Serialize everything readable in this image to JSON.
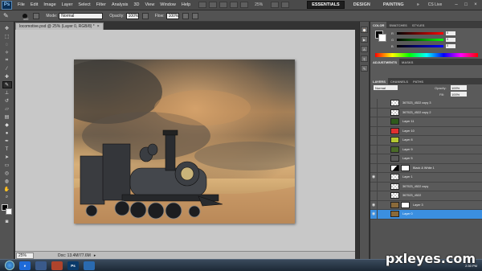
{
  "app": {
    "logo": "Ps",
    "menu": [
      "File",
      "Edit",
      "Image",
      "Layer",
      "Select",
      "Filter",
      "Analysis",
      "3D",
      "View",
      "Window",
      "Help"
    ],
    "zoom_readout": "25%",
    "workspaces": [
      "ESSENTIALS",
      "DESIGN",
      "PAINTING",
      "»"
    ],
    "active_workspace": "ESSENTIALS",
    "cslive": "CS Live"
  },
  "options": {
    "brush_size": "400",
    "mode_label": "Mode:",
    "mode_value": "Normal",
    "opacity_label": "Opacity:",
    "opacity_value": "100%",
    "flow_label": "Flow:",
    "flow_value": "100%"
  },
  "document": {
    "tab_title": "locomotive.psd @ 25% (Layer 0, RGB/8) *",
    "zoom": "25%",
    "doc_info": "Doc: 13.4M/77.6M"
  },
  "color_panel": {
    "tabs": [
      "COLOR",
      "SWATCHES",
      "STYLES"
    ],
    "channels": [
      {
        "label": "R",
        "value": "0"
      },
      {
        "label": "G",
        "value": "0"
      },
      {
        "label": "B",
        "value": "0"
      }
    ]
  },
  "adjust_panel": {
    "tabs": [
      "ADJUSTMENTS",
      "MASKS"
    ]
  },
  "layers_panel": {
    "tabs": [
      "LAYERS",
      "CHANNELS",
      "PATHS"
    ],
    "blend_mode": "Normal",
    "opacity_label": "Opacity:",
    "opacity_value": "100%",
    "fill_label": "Fill:",
    "fill_value": "100%",
    "layers": [
      {
        "name": "367523_4522 copy 3",
        "thumb": "checker",
        "visible": false,
        "selected": false
      },
      {
        "name": "367523_4522 copy 2",
        "thumb": "checker",
        "visible": false,
        "selected": false
      },
      {
        "name": "Layer 11",
        "thumb": "#2f5a1c",
        "visible": false,
        "selected": false
      },
      {
        "name": "Layer 10",
        "thumb": "#e03030",
        "visible": false,
        "selected": false
      },
      {
        "name": "Layer 8",
        "thumb": "#b5c832",
        "visible": false,
        "selected": false
      },
      {
        "name": "Layer 9",
        "thumb": "#4a6a28",
        "visible": false,
        "selected": false
      },
      {
        "name": "Layer 5",
        "thumb": "#5a5a5a",
        "visible": false,
        "selected": false
      },
      {
        "name": "Black & White 1",
        "thumb": "adjust",
        "visible": false,
        "selected": false
      },
      {
        "name": "Layer 1",
        "thumb": "checker",
        "visible": true,
        "selected": false
      },
      {
        "name": "367523_4522 copy",
        "thumb": "checker",
        "visible": false,
        "selected": false
      },
      {
        "name": "367523_4522",
        "thumb": "checker",
        "visible": false,
        "selected": false
      },
      {
        "name": "Layer 3",
        "thumb": "#8a6a3a",
        "visible": true,
        "selected": false
      },
      {
        "name": "Layer 0",
        "thumb": "#8a6a3a",
        "visible": true,
        "selected": true
      }
    ]
  },
  "taskbar": {
    "apps": [
      {
        "label": "e",
        "color": "#1e6ad8"
      },
      {
        "label": "",
        "color": "#3a5a8a"
      },
      {
        "label": "",
        "color": "#b0442c"
      },
      {
        "label": "Ps",
        "color": "#0a3a6a"
      },
      {
        "label": "",
        "color": "#2a6ab0"
      }
    ],
    "tray_time": "2:30 PM"
  },
  "watermark": "pxleyes.com"
}
